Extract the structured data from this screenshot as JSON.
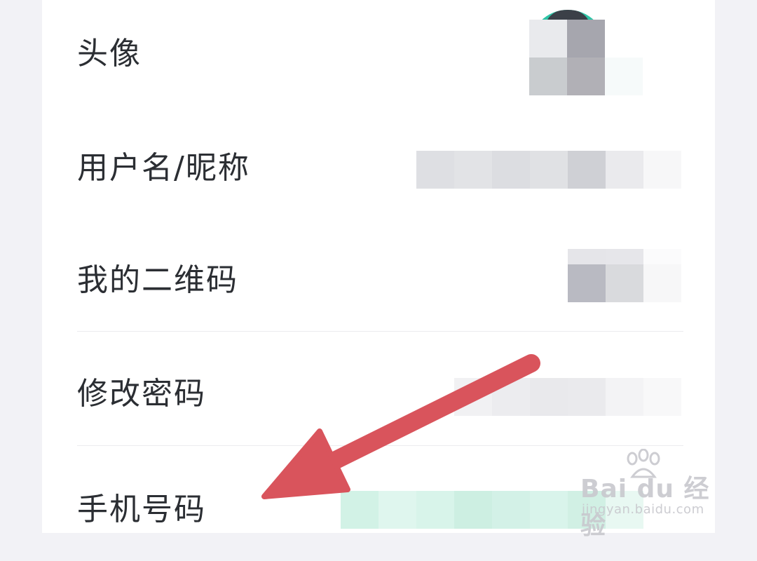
{
  "rows": [
    {
      "label": "头像"
    },
    {
      "label": "用户名/昵称"
    },
    {
      "label": "我的二维码"
    },
    {
      "label": "修改密码"
    },
    {
      "label": "手机号码"
    }
  ],
  "watermark": {
    "main": "Bai du 经验",
    "sub": "jingyan.baidu.com"
  },
  "colors": {
    "arrow": "#d9545c",
    "avatar": "#2ec4a6",
    "background": "#f2f2f6"
  }
}
